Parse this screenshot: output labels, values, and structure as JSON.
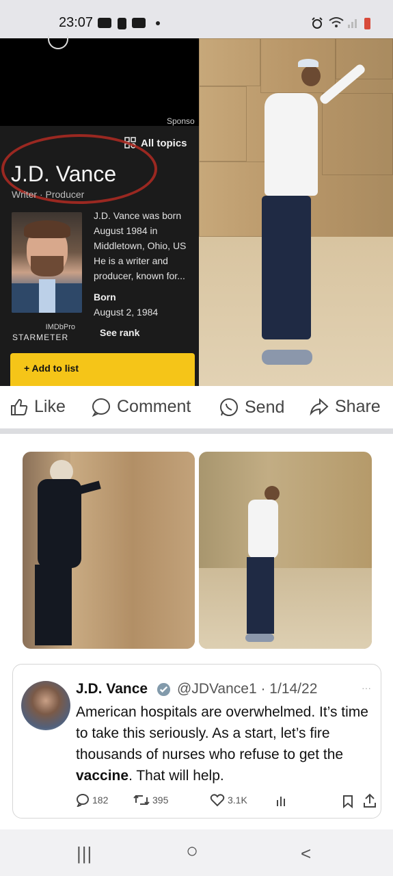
{
  "status_bar": {
    "time": "23:07",
    "icons": [
      "video-icon",
      "notification-icon",
      "video-icon",
      "dot-icon",
      "alarm-icon",
      "wifi-icon",
      "signal-icon",
      "battery-icon"
    ]
  },
  "imdb_card": {
    "sponsored": "Sponso",
    "all_topics": "All topics",
    "name": "J.D. Vance",
    "roles": "Writer · Producer",
    "bio": [
      "J.D. Vance was born",
      "August 1984 in",
      "Middletown, Ohio, US",
      "He is a writer and",
      "producer, known for..."
    ],
    "born_label": "Born",
    "born_date": "August 2, 1984",
    "imdbpro": "IMDbPro",
    "starmeter": "STARMETER",
    "see_rank": "See rank",
    "add_to_list": "+ Add to list",
    "accent": "#f5c518"
  },
  "actions": {
    "like": "Like",
    "comment": "Comment",
    "send": "Send",
    "share": "Share"
  },
  "tweet": {
    "name": "J.D. Vance",
    "handle": "@JDVance1 · 1/14/22",
    "more": "···",
    "text_before": "American hospitals are overwhelmed. It’s time to take this seriously.  As a start, let’s fire thousands of nurses who refuse to get the ",
    "text_bold": "vaccine",
    "text_after": ". That will help.",
    "replies": "182",
    "retweets": "395",
    "likes": "3.1K",
    "verified_color": "#829aab"
  },
  "nav": {
    "recents": "|||",
    "home": "○",
    "back": "<"
  }
}
